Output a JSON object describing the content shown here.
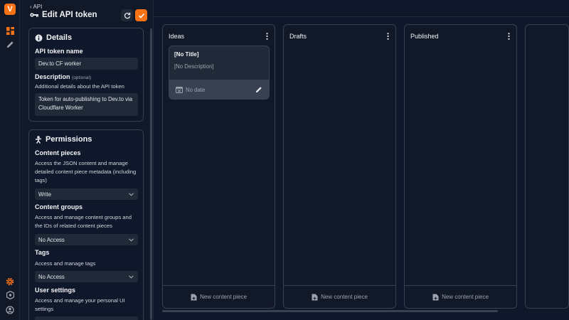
{
  "rail": {
    "logo_letter": "V",
    "icons": [
      "dashboard-icon",
      "pencil-icon",
      "gear-icon",
      "extensions-icon",
      "account-icon"
    ]
  },
  "header": {
    "back_label": "API",
    "title": "Edit API token"
  },
  "details": {
    "heading": "Details",
    "name_label": "API token name",
    "name_value": "Dev.to CF worker",
    "description_label": "Description",
    "optional_label": "(optional)",
    "description_help": "Additional details about the API token",
    "description_value": "Token for auto-publishing to Dev.to via Cloudflare Worker"
  },
  "permissions": {
    "heading": "Permissions",
    "content_pieces": {
      "label": "Content pieces",
      "help": "Access the JSON content and manage detailed content piece metadata (including tags)",
      "value": "Write"
    },
    "content_groups": {
      "label": "Content groups",
      "help": "Access and manage content groups and the IDs of related content pieces",
      "value": "No Access"
    },
    "tags": {
      "label": "Tags",
      "help": "Access and manage tags",
      "value": "No Access"
    },
    "user_settings": {
      "label": "User settings",
      "help": "Access and manage your personal UI settings"
    }
  },
  "board": {
    "columns": [
      {
        "title": "Ideas",
        "footer": "New content piece",
        "piece": {
          "title": "[No Title]",
          "description": "[No Description]",
          "date": "No date"
        }
      },
      {
        "title": "Drafts",
        "footer": "New content piece"
      },
      {
        "title": "Published",
        "footer": "New content piece"
      }
    ]
  },
  "colors": {
    "accent": "#f97316",
    "background": "#0f172a",
    "surface": "#111827",
    "border": "#374151"
  }
}
